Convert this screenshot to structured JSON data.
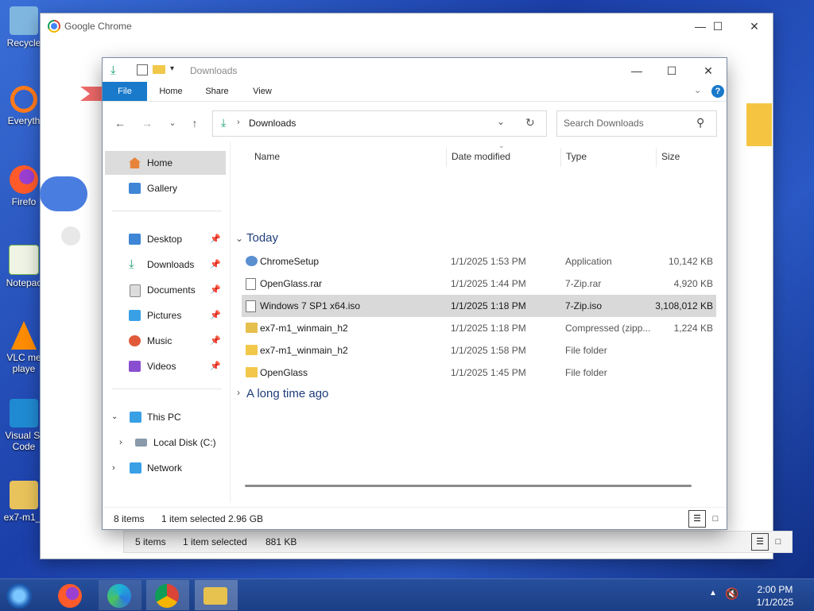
{
  "desktop": {
    "icons": [
      {
        "label": "Recycle",
        "color": "#7fb6e0"
      },
      {
        "label": "Everyth",
        "color": "#ff7a1a"
      },
      {
        "label": "Firefo",
        "color": "#ff5a2a"
      },
      {
        "label": "Notepac",
        "color": "#77b34d"
      },
      {
        "label": "VLC me",
        "sub": "playe",
        "color": "#ff8c00"
      },
      {
        "label": "Visual St",
        "sub": "Code",
        "color": "#1f8ad2"
      },
      {
        "label": "ex7-m1_(",
        "color": "#e8c25a"
      }
    ]
  },
  "chrome": {
    "title": "Google Chrome",
    "status_items": "5 items",
    "status_selected": "1 item selected",
    "status_size": "881 KB"
  },
  "explorer": {
    "title": "Downloads",
    "ribbon_tabs": [
      "File",
      "Home",
      "Share",
      "View"
    ],
    "address_location": "Downloads",
    "search_placeholder": "Search Downloads",
    "nav": {
      "home": "Home",
      "gallery": "Gallery",
      "desktop": "Desktop",
      "downloads": "Downloads",
      "documents": "Documents",
      "pictures": "Pictures",
      "music": "Music",
      "videos": "Videos",
      "this_pc": "This PC",
      "local_disk": "Local Disk (C:)",
      "network": "Network"
    },
    "columns": {
      "name": "Name",
      "date": "Date modified",
      "type": "Type",
      "size": "Size"
    },
    "groups": {
      "today": "Today",
      "long_ago": "A long time ago"
    },
    "files": [
      {
        "name": "ChromeSetup",
        "date": "1/1/2025 1:53 PM",
        "type": "Application",
        "size": "10,142 KB",
        "icon": "#5a8fd0"
      },
      {
        "name": "OpenGlass.rar",
        "date": "1/1/2025 1:44 PM",
        "type": "7-Zip.rar",
        "size": "4,920 KB",
        "icon": "#cfcfcf"
      },
      {
        "name": "Windows 7 SP1 x64.iso",
        "date": "1/1/2025 1:18 PM",
        "type": "7-Zip.iso",
        "size": "3,108,012 KB",
        "icon": "#cfcfcf"
      },
      {
        "name": "ex7-m1_winmain_h2",
        "date": "1/1/2025 1:18 PM",
        "type": "Compressed (zipp...",
        "size": "1,224 KB",
        "icon": "#e6c04c"
      },
      {
        "name": "ex7-m1_winmain_h2",
        "date": "1/1/2025 1:58 PM",
        "type": "File folder",
        "size": "",
        "icon": "#f2c84b"
      },
      {
        "name": "OpenGlass",
        "date": "1/1/2025 1:45 PM",
        "type": "File folder",
        "size": "",
        "icon": "#f2c84b"
      }
    ],
    "status_items": "8 items",
    "status_selected": "1 item selected",
    "status_size": "2.96 GB"
  },
  "taskbar": {
    "time": "2:00 PM",
    "date": "1/1/2025"
  }
}
